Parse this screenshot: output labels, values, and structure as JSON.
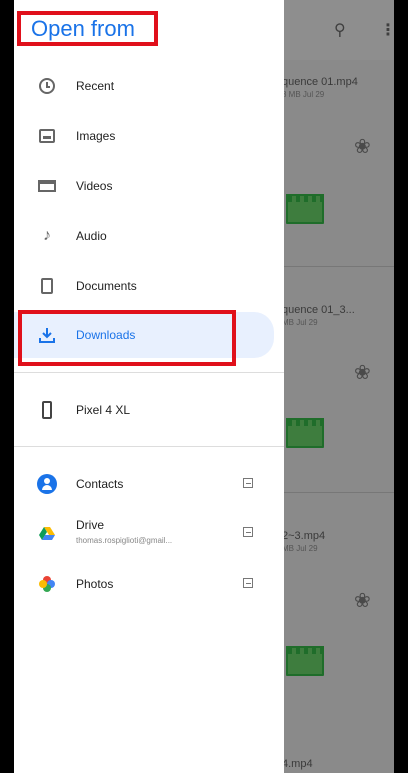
{
  "drawer": {
    "title": "Open from",
    "items": [
      {
        "label": "Recent",
        "icon": "clock-icon"
      },
      {
        "label": "Images",
        "icon": "image-icon"
      },
      {
        "label": "Videos",
        "icon": "video-icon"
      },
      {
        "label": "Audio",
        "icon": "music-note-icon"
      },
      {
        "label": "Documents",
        "icon": "document-icon"
      },
      {
        "label": "Downloads",
        "icon": "download-icon",
        "selected": true
      }
    ],
    "device": {
      "label": "Pixel 4 XL",
      "icon": "phone-icon"
    },
    "apps": [
      {
        "label": "Contacts",
        "icon": "contacts-icon"
      },
      {
        "label": "Drive",
        "sub": "thomas.rospiglioti@gmail...",
        "icon": "drive-icon"
      },
      {
        "label": "Photos",
        "icon": "photos-icon"
      }
    ]
  },
  "background": {
    "files": [
      {
        "name": "quence 01.mp4",
        "meta": "8 MB Jul 29"
      },
      {
        "name": "quence 01_3...",
        "meta": "MB Jul 29"
      },
      {
        "name": "2~3.mp4",
        "meta": "MB Jul 29"
      },
      {
        "name": "4.mp4",
        "meta": ""
      }
    ]
  },
  "colors": {
    "accent": "#1a73e8",
    "highlight": "#e0101b",
    "selected_bg": "#e8f0fe"
  }
}
